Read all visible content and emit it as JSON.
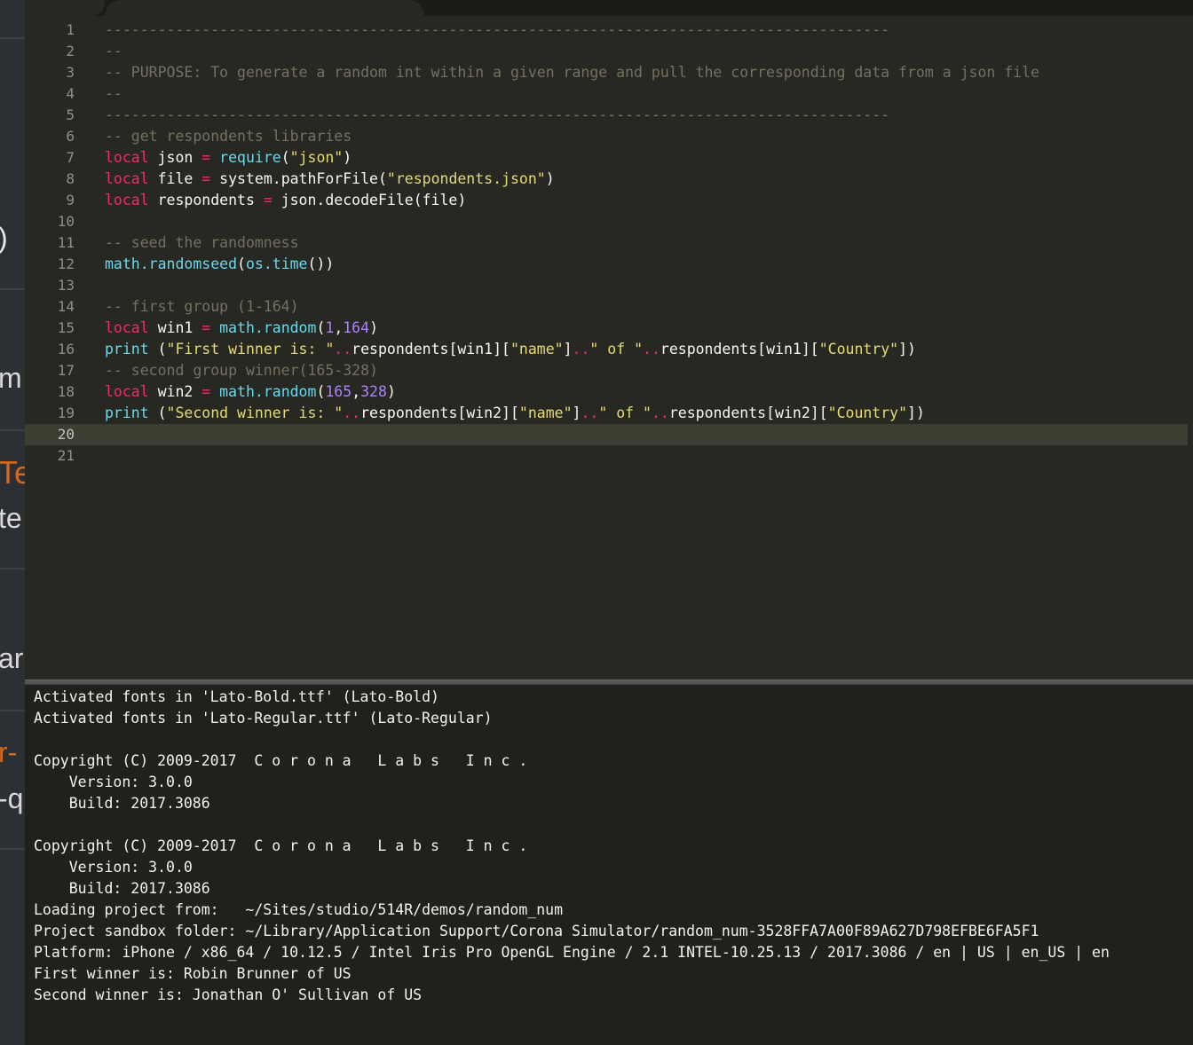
{
  "left_strip": {
    "fragments": [
      ")",
      "m",
      "Te",
      "te",
      "ar",
      "r-",
      "-q"
    ]
  },
  "editor": {
    "current_line": 20,
    "line_numbers": [
      "1",
      "2",
      "3",
      "4",
      "5",
      "6",
      "7",
      "8",
      "9",
      "10",
      "11",
      "12",
      "13",
      "14",
      "15",
      "16",
      "17",
      "18",
      "19",
      "20",
      "21"
    ],
    "lines": [
      [
        {
          "t": "-----------------------------------------------------------------------------------------",
          "c": "com"
        }
      ],
      [
        {
          "t": "--",
          "c": "com"
        }
      ],
      [
        {
          "t": "-- PURPOSE: To generate a random int within a given range and pull the corresponding data from a json file",
          "c": "com"
        }
      ],
      [
        {
          "t": "--",
          "c": "com"
        }
      ],
      [
        {
          "t": "-----------------------------------------------------------------------------------------",
          "c": "com"
        }
      ],
      [
        {
          "t": "-- get respondents libraries",
          "c": "com"
        }
      ],
      [
        {
          "t": "local",
          "c": "kw"
        },
        {
          "t": " json ",
          "c": "var"
        },
        {
          "t": "=",
          "c": "op"
        },
        {
          "t": " ",
          "c": "var"
        },
        {
          "t": "require",
          "c": "fn"
        },
        {
          "t": "(",
          "c": "var"
        },
        {
          "t": "\"json\"",
          "c": "str"
        },
        {
          "t": ")",
          "c": "var"
        }
      ],
      [
        {
          "t": "local",
          "c": "kw"
        },
        {
          "t": " file ",
          "c": "var"
        },
        {
          "t": "=",
          "c": "op"
        },
        {
          "t": " system.pathForFile(",
          "c": "var"
        },
        {
          "t": "\"respondents.json\"",
          "c": "str"
        },
        {
          "t": ")",
          "c": "var"
        }
      ],
      [
        {
          "t": "local",
          "c": "kw"
        },
        {
          "t": " respondents ",
          "c": "var"
        },
        {
          "t": "=",
          "c": "op"
        },
        {
          "t": " json.decodeFile(file)",
          "c": "var"
        }
      ],
      [],
      [
        {
          "t": "-- seed the randomness",
          "c": "com"
        }
      ],
      [
        {
          "t": "math.randomseed",
          "c": "fn"
        },
        {
          "t": "(",
          "c": "var"
        },
        {
          "t": "os.time",
          "c": "fn"
        },
        {
          "t": "())",
          "c": "var"
        }
      ],
      [],
      [
        {
          "t": "-- first group (1-164)",
          "c": "com"
        }
      ],
      [
        {
          "t": "local",
          "c": "kw"
        },
        {
          "t": " win1 ",
          "c": "var"
        },
        {
          "t": "=",
          "c": "op"
        },
        {
          "t": " ",
          "c": "var"
        },
        {
          "t": "math.random",
          "c": "fn"
        },
        {
          "t": "(",
          "c": "var"
        },
        {
          "t": "1",
          "c": "num"
        },
        {
          "t": ",",
          "c": "var"
        },
        {
          "t": "164",
          "c": "num"
        },
        {
          "t": ")",
          "c": "var"
        }
      ],
      [
        {
          "t": "print",
          "c": "fn"
        },
        {
          "t": " (",
          "c": "var"
        },
        {
          "t": "\"First winner is: \"",
          "c": "str"
        },
        {
          "t": "..",
          "c": "op"
        },
        {
          "t": "respondents[win1][",
          "c": "var"
        },
        {
          "t": "\"name\"",
          "c": "str"
        },
        {
          "t": "]",
          "c": "var"
        },
        {
          "t": "..",
          "c": "op"
        },
        {
          "t": "\" of \"",
          "c": "str"
        },
        {
          "t": "..",
          "c": "op"
        },
        {
          "t": "respondents[win1][",
          "c": "var"
        },
        {
          "t": "\"Country\"",
          "c": "str"
        },
        {
          "t": "])",
          "c": "var"
        }
      ],
      [
        {
          "t": "-- second group winner(165-328)",
          "c": "com"
        }
      ],
      [
        {
          "t": "local",
          "c": "kw"
        },
        {
          "t": " win2 ",
          "c": "var"
        },
        {
          "t": "=",
          "c": "op"
        },
        {
          "t": " ",
          "c": "var"
        },
        {
          "t": "math.random",
          "c": "fn"
        },
        {
          "t": "(",
          "c": "var"
        },
        {
          "t": "165",
          "c": "num"
        },
        {
          "t": ",",
          "c": "var"
        },
        {
          "t": "328",
          "c": "num"
        },
        {
          "t": ")",
          "c": "var"
        }
      ],
      [
        {
          "t": "print",
          "c": "fn"
        },
        {
          "t": " (",
          "c": "var"
        },
        {
          "t": "\"Second winner is: \"",
          "c": "str"
        },
        {
          "t": "..",
          "c": "op"
        },
        {
          "t": "respondents[win2][",
          "c": "var"
        },
        {
          "t": "\"name\"",
          "c": "str"
        },
        {
          "t": "]",
          "c": "var"
        },
        {
          "t": "..",
          "c": "op"
        },
        {
          "t": "\" of \"",
          "c": "str"
        },
        {
          "t": "..",
          "c": "op"
        },
        {
          "t": "respondents[win2][",
          "c": "var"
        },
        {
          "t": "\"Country\"",
          "c": "str"
        },
        {
          "t": "])",
          "c": "var"
        }
      ],
      [],
      []
    ]
  },
  "console": {
    "lines": [
      "Activated fonts in 'Lato-Bold.ttf' (Lato-Bold)",
      "Activated fonts in 'Lato-Regular.ttf' (Lato-Regular)",
      "",
      "Copyright (C) 2009-2017  C o r o n a   L a b s   I n c .",
      "    Version: 3.0.0",
      "    Build: 2017.3086",
      "",
      "Copyright (C) 2009-2017  C o r o n a   L a b s   I n c .",
      "    Version: 3.0.0",
      "    Build: 2017.3086",
      "Loading project from:   ~/Sites/studio/514R/demos/random_num",
      "Project sandbox folder: ~/Library/Application Support/Corona Simulator/random_num-3528FFA7A00F89A627D798EFBE6FA5F1",
      "Platform: iPhone / x86_64 / 10.12.5 / Intel Iris Pro OpenGL Engine / 2.1 INTEL-10.25.13 / 2017.3086 / en | US | en_US | en",
      "First winner is: Robin Brunner of US",
      "Second winner is: Jonathan O' Sullivan of US"
    ]
  },
  "colors": {
    "background": "#272822",
    "comment": "#75715e",
    "keyword": "#f92672",
    "function": "#66d9ef",
    "string": "#e6db74",
    "number": "#ae81ff",
    "console_bg": "#20211d"
  }
}
